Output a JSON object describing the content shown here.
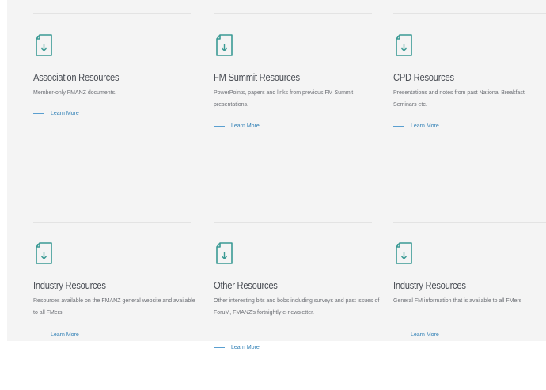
{
  "colors": {
    "panel_background": "#f4f4f4",
    "icon_teal": "#3a9a94",
    "link_blue": "#2f7fb5",
    "title_text": "#4a4e55",
    "body_text": "#6c6f75"
  },
  "cards": [
    {
      "icon": "download-document-icon",
      "title": "Association Resources",
      "description": "Member-only FMANZ documents.",
      "link": "Learn More"
    },
    {
      "icon": "download-document-icon",
      "title": "FM Summit Resources",
      "description": "PowerPoints, papers and links from previous FM Summit presentations.",
      "link": "Learn More"
    },
    {
      "icon": "download-document-icon",
      "title": "CPD Resources",
      "description": "Presentations and notes from past National Breakfast Seminars etc.",
      "link": "Learn More"
    },
    {
      "icon": "download-document-icon",
      "title": "Industry Resources",
      "description": "Resources available on the FMANZ general website and available to all FMers.",
      "link": "Learn More"
    },
    {
      "icon": "download-document-icon",
      "title": "Other Resources",
      "description": "Other interesting bits and bobs including surveys and past issues of ForuM, FMANZ's fortnightly e-newsletter.",
      "link": "Learn More"
    },
    {
      "icon": "download-document-icon",
      "title": "Industry Resources",
      "description": "General FM information that is available to all FMers",
      "link": "Learn More"
    }
  ]
}
